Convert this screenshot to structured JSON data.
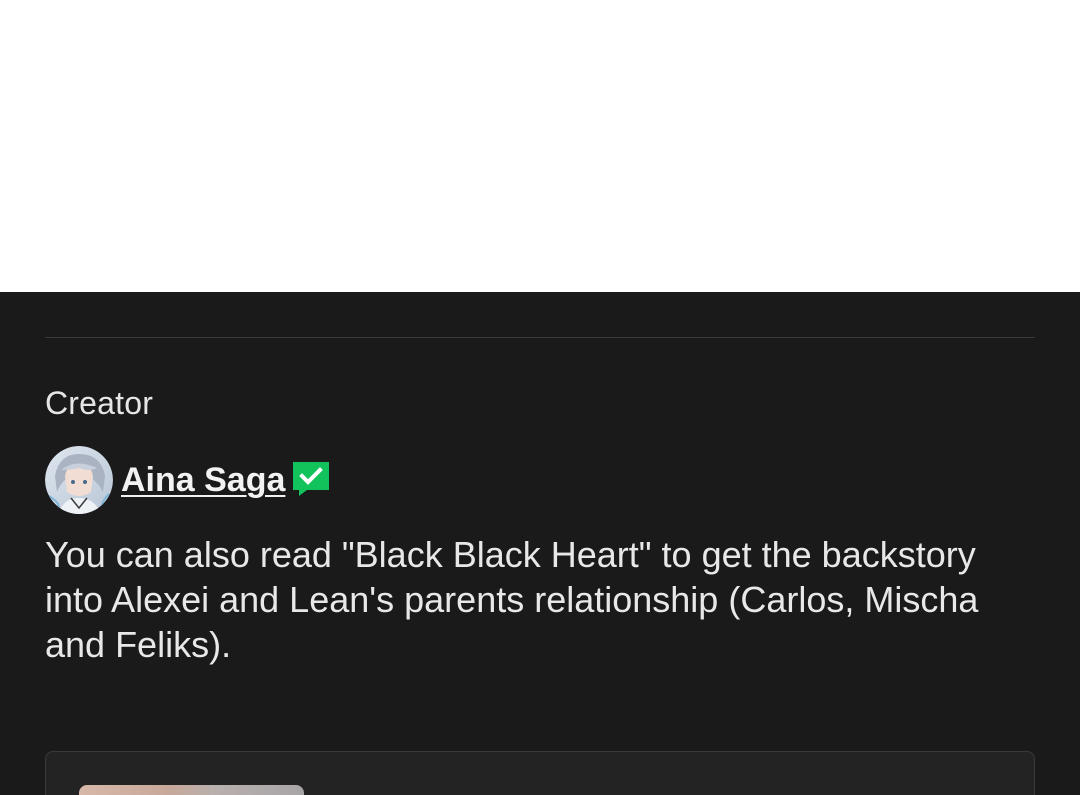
{
  "creator_section": {
    "label": "Creator",
    "creator": {
      "name": "Aina Saga",
      "avatar_icon": "anime-avatar",
      "verified_icon": "verified-badge-icon",
      "verified_color": "#12c25a"
    }
  },
  "description": "You can also read \"Black Black Heart\" to get the backstory into Alexei and Lean's parents relationship (Carlos, Mischa and Feliks).",
  "colors": {
    "panel_background": "#1a1a1a",
    "text": "#e8e8e8",
    "divider": "#3a3a3a"
  }
}
